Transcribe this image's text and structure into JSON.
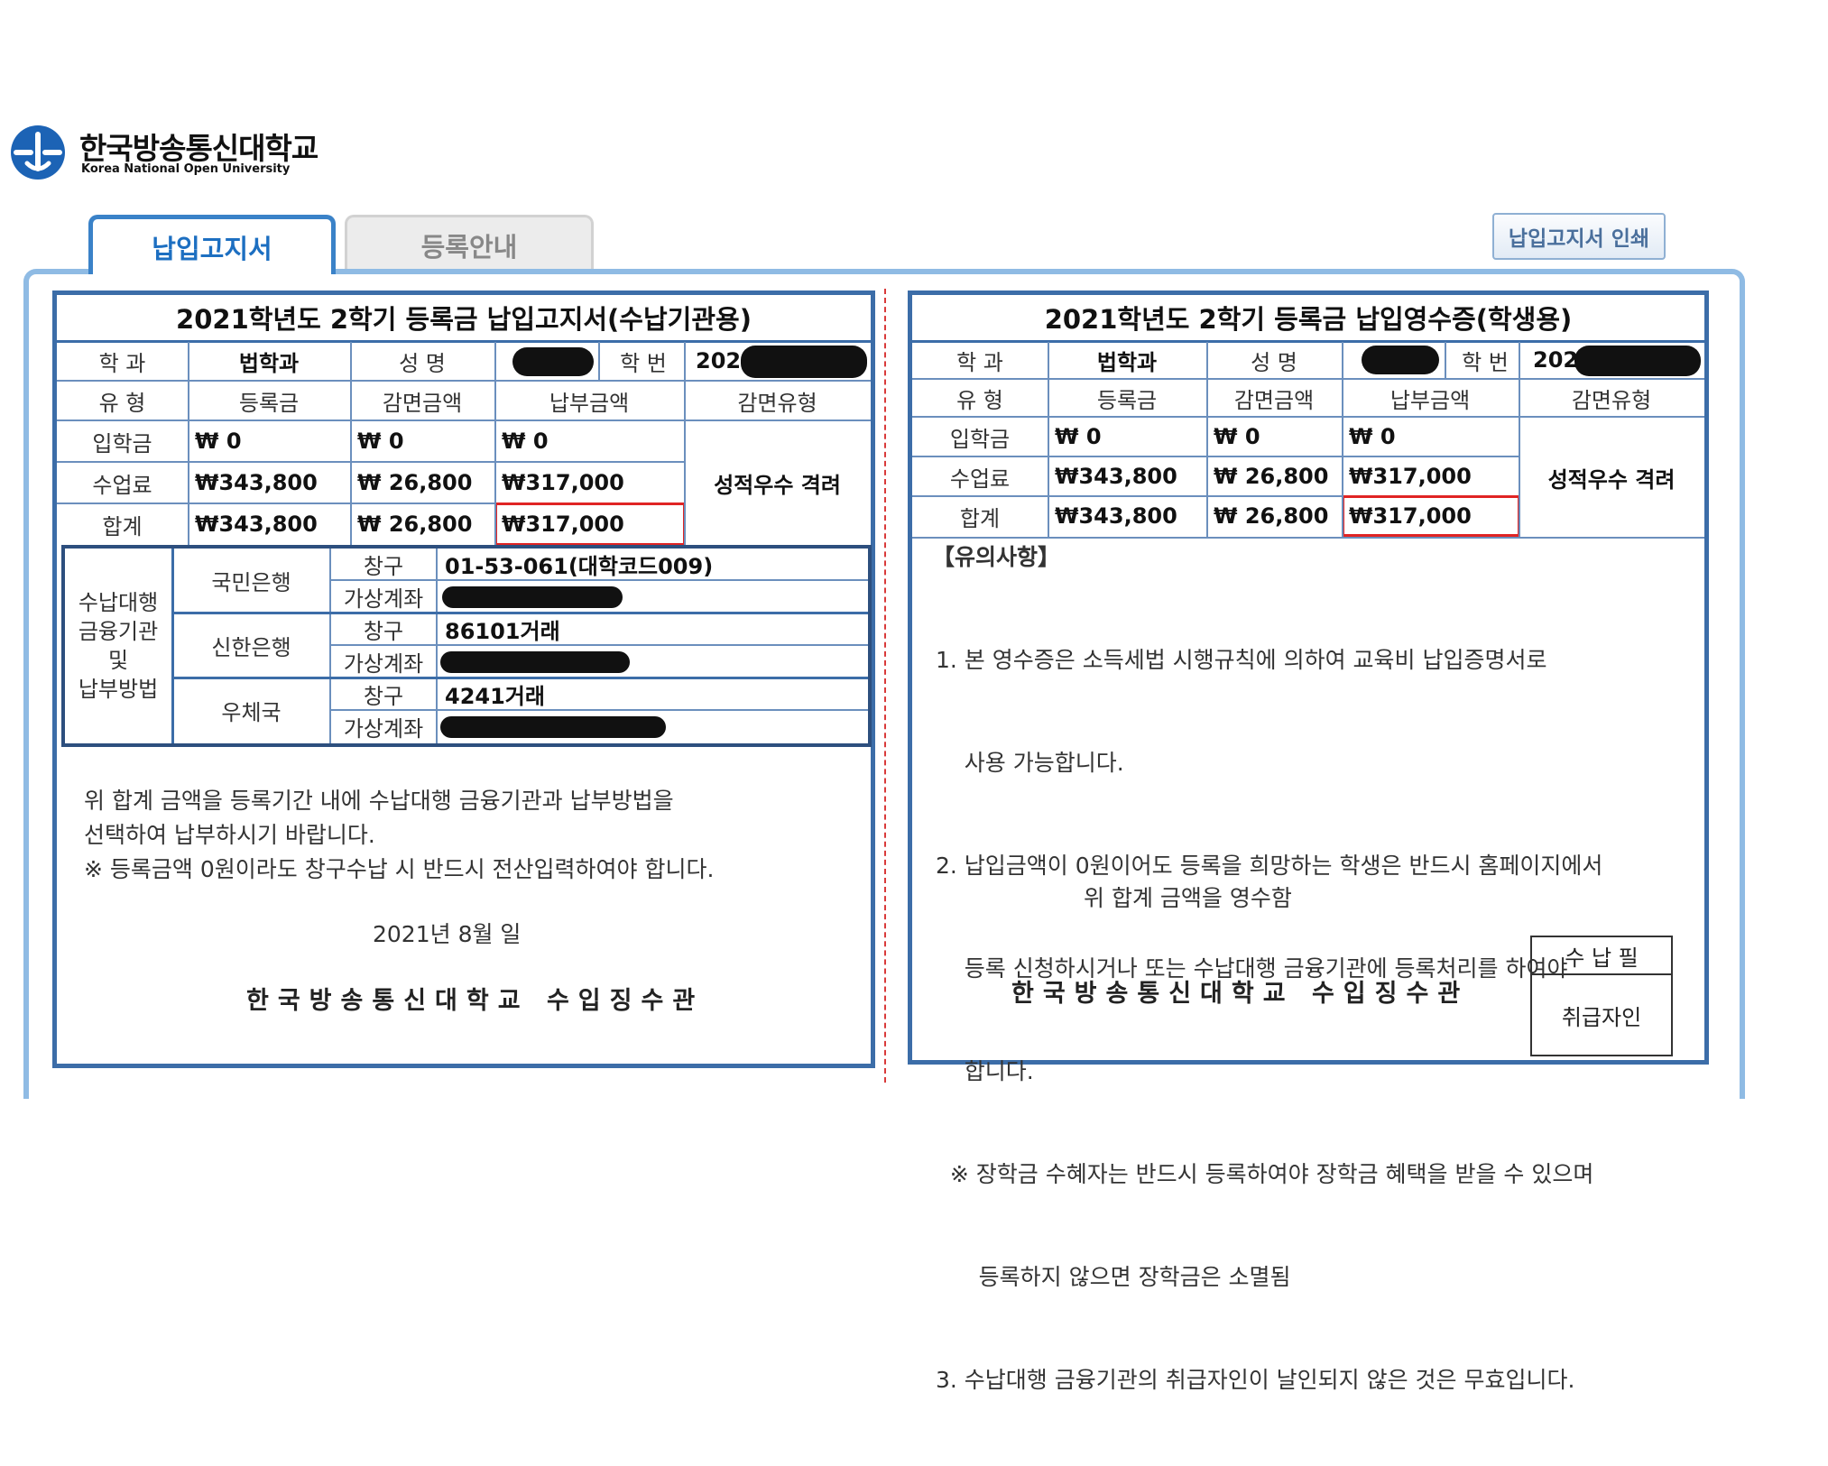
{
  "logo": {
    "name_ko": "한국방송통신대학교",
    "name_en": "Korea National Open University"
  },
  "tabs": [
    {
      "label": "납입고지서",
      "active": true
    },
    {
      "label": "등록안내",
      "active": false
    }
  ],
  "print_button": "납입고지서 인쇄",
  "colors": {
    "frame": "#8fbbe4",
    "panel_border": "#3c6da8",
    "tab_active_text": "#1d6fc1",
    "highlight_box": "#e02424",
    "divider": "#d93a3a"
  },
  "left": {
    "title": "2021학년도 2학기 등록금 납입고지서(수납기관용)",
    "header_labels": {
      "dept": "학 과",
      "name": "성 명",
      "student_no": "학 번"
    },
    "dept_value": "법학과",
    "student_no_prefix": "202",
    "columns": [
      "유 형",
      "등록금",
      "감면금액",
      "납부금액",
      "감면유형"
    ],
    "rows": [
      {
        "label": "입학금",
        "tuition": "₩ 0",
        "reduction": "₩ 0",
        "payment": "₩ 0"
      },
      {
        "label": "수업료",
        "tuition": "₩343,800",
        "reduction": "₩ 26,800",
        "payment": "₩317,000"
      },
      {
        "label": "합계",
        "tuition": "₩343,800",
        "reduction": "₩ 26,800",
        "payment": "₩317,000"
      }
    ],
    "reduction_type": "성적우수 격려",
    "bank_section_label": [
      "수납대행",
      "금융기관",
      "및",
      "납부방법"
    ],
    "banks": [
      {
        "name": "국민은행",
        "counter_label": "창구",
        "counter_value": "01-53-061(대학코드009)",
        "virtual_label": "가상계좌"
      },
      {
        "name": "신한은행",
        "counter_label": "창구",
        "counter_value": "86101거래",
        "virtual_label": "가상계좌"
      },
      {
        "name": "우체국",
        "counter_label": "창구",
        "counter_value": "4241거래",
        "virtual_label": "가상계좌"
      }
    ],
    "notice_lines": [
      "위 합계 금액을 등록기간 내에 수납대행 금융기관과 납부방법을",
      "선택하여 납부하시기 바랍니다.",
      "※ 등록금액 0원이라도 창구수납 시 반드시 전산입력하여야 합니다."
    ],
    "date": "2021년   8월    일",
    "signature": "한국방송통신대학교 수입징수관"
  },
  "right": {
    "title": "2021학년도 2학기 등록금 납입영수증(학생용)",
    "header_labels": {
      "dept": "학 과",
      "name": "성 명",
      "student_no": "학 번"
    },
    "dept_value": "법학과",
    "student_no_prefix": "202",
    "columns": [
      "유 형",
      "등록금",
      "감면금액",
      "납부금액",
      "감면유형"
    ],
    "rows": [
      {
        "label": "입학금",
        "tuition": "₩ 0",
        "reduction": "₩ 0",
        "payment": "₩ 0"
      },
      {
        "label": "수업료",
        "tuition": "₩343,800",
        "reduction": "₩ 26,800",
        "payment": "₩317,000"
      },
      {
        "label": "합계",
        "tuition": "₩343,800",
        "reduction": "₩ 26,800",
        "payment": "₩317,000"
      }
    ],
    "reduction_type": "성적우수 격려",
    "notes_title": "【유의사항】",
    "notes": [
      "1. 본 영수증은 소득세법 시행규칙에 의하여 교육비 납입증명서로",
      "    사용 가능합니다.",
      "2. 납입금액이 0원이어도 등록을 희망하는 학생은 반드시 홈페이지에서",
      "    등록 신청하시거나 또는 수납대행 금융기관에 등록처리를 하여야",
      "    합니다.",
      "  ※ 장학금 수혜자는 반드시 등록하여야 장학금 혜택을 받을 수 있으며",
      "      등록하지 않으면 장학금은 소멸됨",
      "3. 수납대행 금융기관의 취급자인이 날인되지 않은 것은 무효입니다."
    ],
    "receipt_line": "위 합계 금액을 영수함",
    "signature": "한국방송통신대학교 수입징수관",
    "stamp": {
      "top": "수 납 필",
      "bottom": "취급자인"
    }
  }
}
